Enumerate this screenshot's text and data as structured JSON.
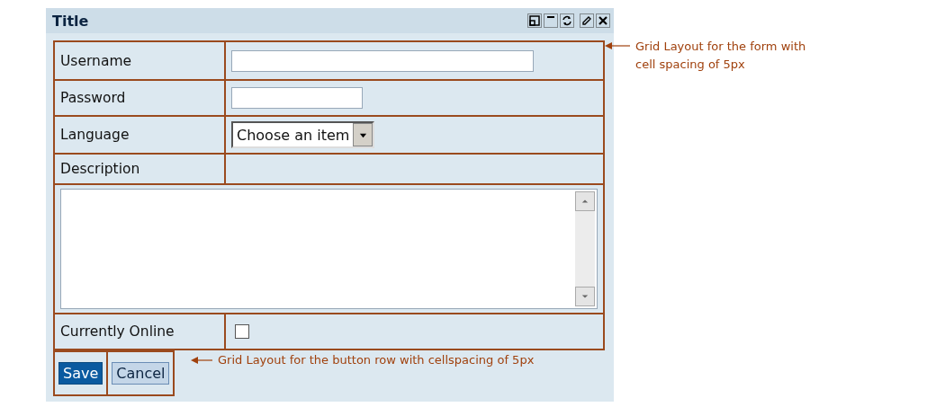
{
  "panel": {
    "title": "Title"
  },
  "form_rows": [
    {
      "kind": "text",
      "label": "Username"
    },
    {
      "kind": "password",
      "label": "Password"
    },
    {
      "kind": "select",
      "label": "Language",
      "value": "Choose an item"
    },
    {
      "kind": "label",
      "label": "Description"
    },
    {
      "kind": "textarea"
    },
    {
      "kind": "checkbox",
      "label": "Currently Online",
      "checked": false
    }
  ],
  "buttons": [
    {
      "label": "Save",
      "selected": true
    },
    {
      "label": "Cancel",
      "selected": false
    }
  ],
  "annotations": [
    {
      "text": "Grid Layout for the form with cell spacing of 5px"
    },
    {
      "text": "Grid Layout for the button row with cellspacing of 5px"
    }
  ]
}
